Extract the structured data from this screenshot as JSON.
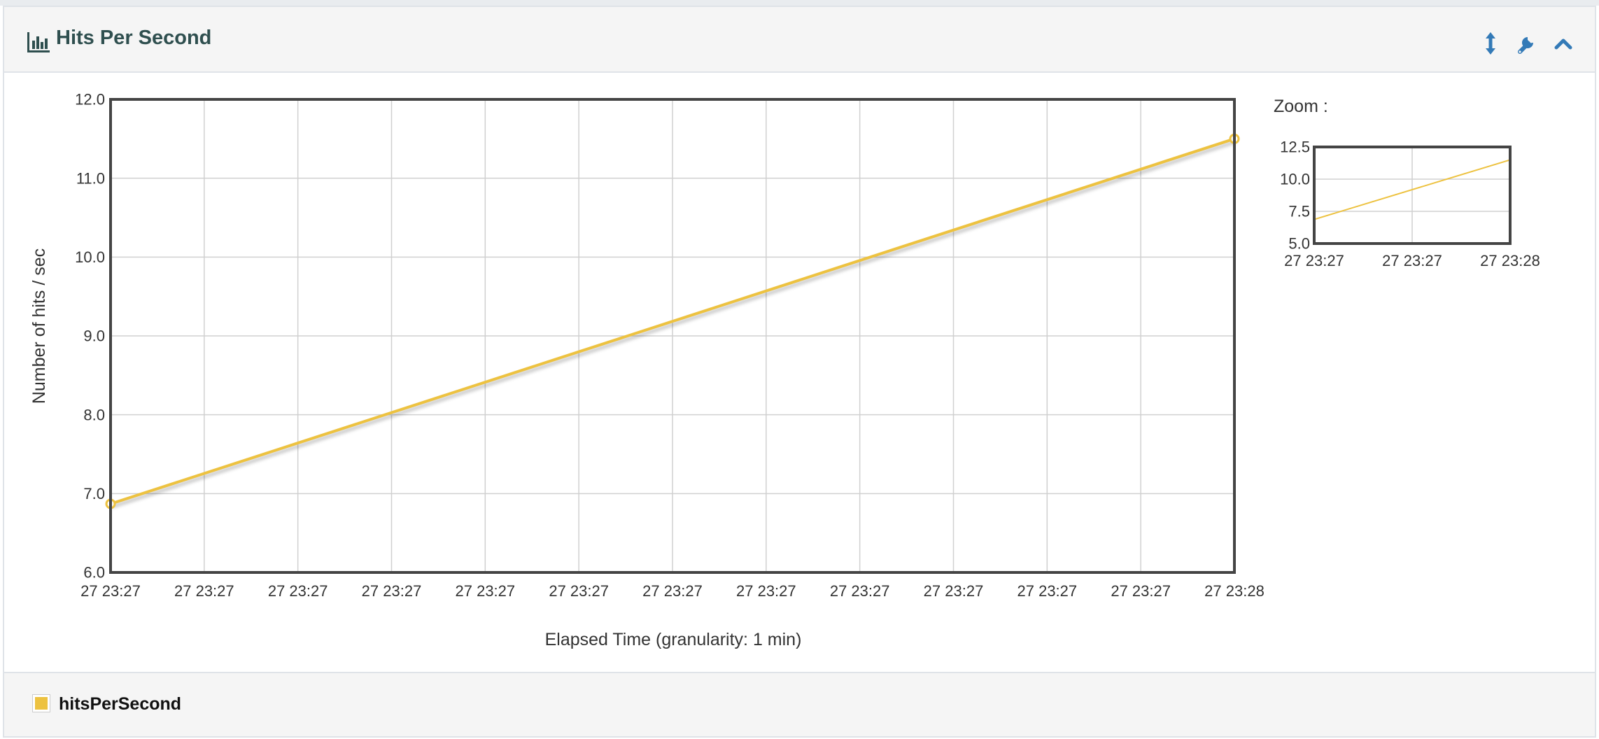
{
  "panel": {
    "title": "Hits Per Second",
    "title_icon": "bar-chart-icon",
    "toolbar_icons": [
      "resize-vertical-icon",
      "wrench-icon",
      "chevron-up-icon"
    ],
    "accent_color": "#337ab7"
  },
  "zoom": {
    "label": "Zoom :"
  },
  "legend": [
    {
      "label": "hitsPerSecond",
      "color": "#EDC240"
    }
  ],
  "chart_data": [
    {
      "type": "line",
      "title": "",
      "xlabel": "Elapsed Time (granularity: 1 min)",
      "ylabel": "Number of hits / sec",
      "x_tick_labels": [
        "27 23:27",
        "27 23:27",
        "27 23:27",
        "27 23:27",
        "27 23:27",
        "27 23:27",
        "27 23:27",
        "27 23:27",
        "27 23:27",
        "27 23:27",
        "27 23:27",
        "27 23:27",
        "27 23:28"
      ],
      "y_tick_labels": [
        "6.0",
        "7.0",
        "8.0",
        "9.0",
        "10.0",
        "11.0",
        "12.0"
      ],
      "ylim": [
        6,
        12
      ],
      "grid": true,
      "series": [
        {
          "name": "hitsPerSecond",
          "color": "#EDC240",
          "points": [
            {
              "x": 0,
              "y": 6.87
            },
            {
              "x": 12,
              "y": 11.5
            }
          ]
        }
      ]
    },
    {
      "type": "line",
      "title": "",
      "x_tick_labels": [
        "27 23:27",
        "27 23:27",
        "27 23:28"
      ],
      "y_tick_labels": [
        "5.0",
        "7.5",
        "10.0",
        "12.5"
      ],
      "ylim": [
        5,
        12.5
      ],
      "grid": true,
      "series": [
        {
          "name": "hitsPerSecond",
          "color": "#EDC240",
          "points": [
            {
              "x": 0,
              "y": 6.87
            },
            {
              "x": 2,
              "y": 11.5
            }
          ]
        }
      ]
    }
  ]
}
